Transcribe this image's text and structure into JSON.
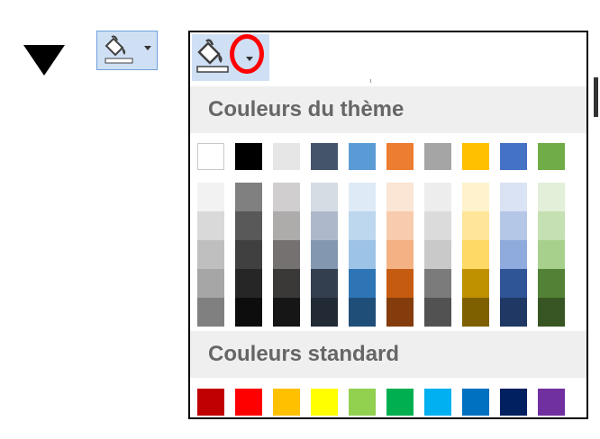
{
  "theme_header": "Couleurs du thème",
  "standard_header": "Couleurs standard",
  "theme_colors": [
    "#ffffff",
    "#000000",
    "#e7e6e6",
    "#44546a",
    "#5b9bd5",
    "#ed7d31",
    "#a5a5a5",
    "#ffc000",
    "#4472c4",
    "#70ad47"
  ],
  "theme_shades": [
    [
      "#f2f2f2",
      "#d9d9d9",
      "#bfbfbf",
      "#a6a6a6",
      "#808080"
    ],
    [
      "#808080",
      "#595959",
      "#404040",
      "#262626",
      "#0d0d0d"
    ],
    [
      "#d0cece",
      "#aeabab",
      "#757171",
      "#3b3838",
      "#171616"
    ],
    [
      "#d6dce4",
      "#adb9ca",
      "#8497b0",
      "#333f4f",
      "#222a35"
    ],
    [
      "#deebf6",
      "#bdd7ee",
      "#9dc3e6",
      "#2e75b6",
      "#1f4e79"
    ],
    [
      "#fbe5d5",
      "#f7cbac",
      "#f4b183",
      "#c55a11",
      "#843c0c"
    ],
    [
      "#ededed",
      "#dbdbdb",
      "#c9c9c9",
      "#7b7b7b",
      "#525252"
    ],
    [
      "#fff2cc",
      "#ffe599",
      "#ffd966",
      "#bf9000",
      "#7f6000"
    ],
    [
      "#dae3f3",
      "#b4c7e7",
      "#8faadc",
      "#2f5597",
      "#1f3864"
    ],
    [
      "#e2efd9",
      "#c5e0b3",
      "#a8d08d",
      "#538135",
      "#375623"
    ]
  ],
  "standard_colors": [
    "#c00000",
    "#ff0000",
    "#ffc000",
    "#ffff00",
    "#92d050",
    "#00b050",
    "#00b0f0",
    "#0070c0",
    "#002060",
    "#7030a0"
  ],
  "icons": {
    "arrow": "down-triangle-icon",
    "fill": "paint-bucket-icon",
    "dropdown": "chevron-down-icon"
  },
  "highlight_color": "#ff0000"
}
